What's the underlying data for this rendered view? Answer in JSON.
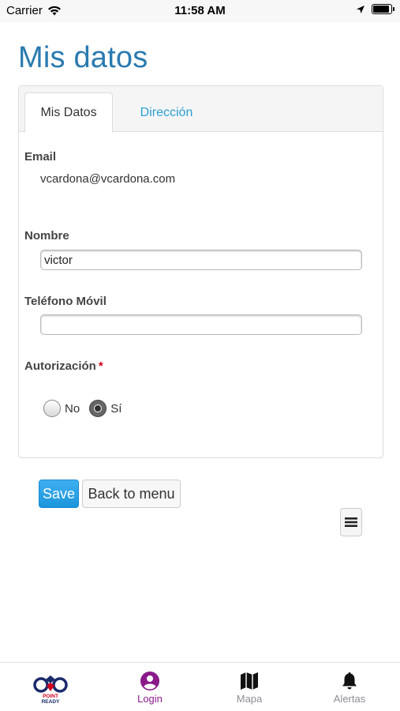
{
  "status_bar": {
    "carrier": "Carrier",
    "time": "11:58 AM",
    "wifi_icon": "wifi-icon",
    "location_icon": "location-arrow-icon",
    "battery_icon": "battery-icon",
    "battery_level": 0.9
  },
  "page": {
    "title": "Mis datos"
  },
  "tabs": {
    "active_label": "Mis Datos",
    "inactive_label": "Dirección"
  },
  "form": {
    "email_label": "Email",
    "email_value": "vcardona@vcardona.com",
    "nombre_label": "Nombre",
    "nombre_value": "victor",
    "telefono_label": "Teléfono Móvil",
    "telefono_value": "",
    "autorizacion_label": "Autorización",
    "required_mark": "*",
    "radio_no_label": "No",
    "radio_si_label": "Sí",
    "selected": "Sí"
  },
  "actions": {
    "save_label": "Save",
    "back_label": "Back to menu",
    "menu_icon": "hamburger-menu-icon"
  },
  "bottom_nav": {
    "logo_text_1": "POINT",
    "logo_text_2": "READY",
    "items": [
      {
        "label": "Login",
        "icon": "user-circle-icon",
        "active": true
      },
      {
        "label": "Mapa",
        "icon": "map-icon",
        "active": false
      },
      {
        "label": "Alertas",
        "icon": "bell-icon",
        "active": false
      }
    ]
  },
  "colors": {
    "title_blue": "#2a7ab0",
    "link_blue": "#2a9fd6",
    "save_blue": "#1a95dc",
    "nav_active": "#8a1a8a",
    "nav_inactive": "#8e8e93",
    "required_red": "#d0021b"
  }
}
